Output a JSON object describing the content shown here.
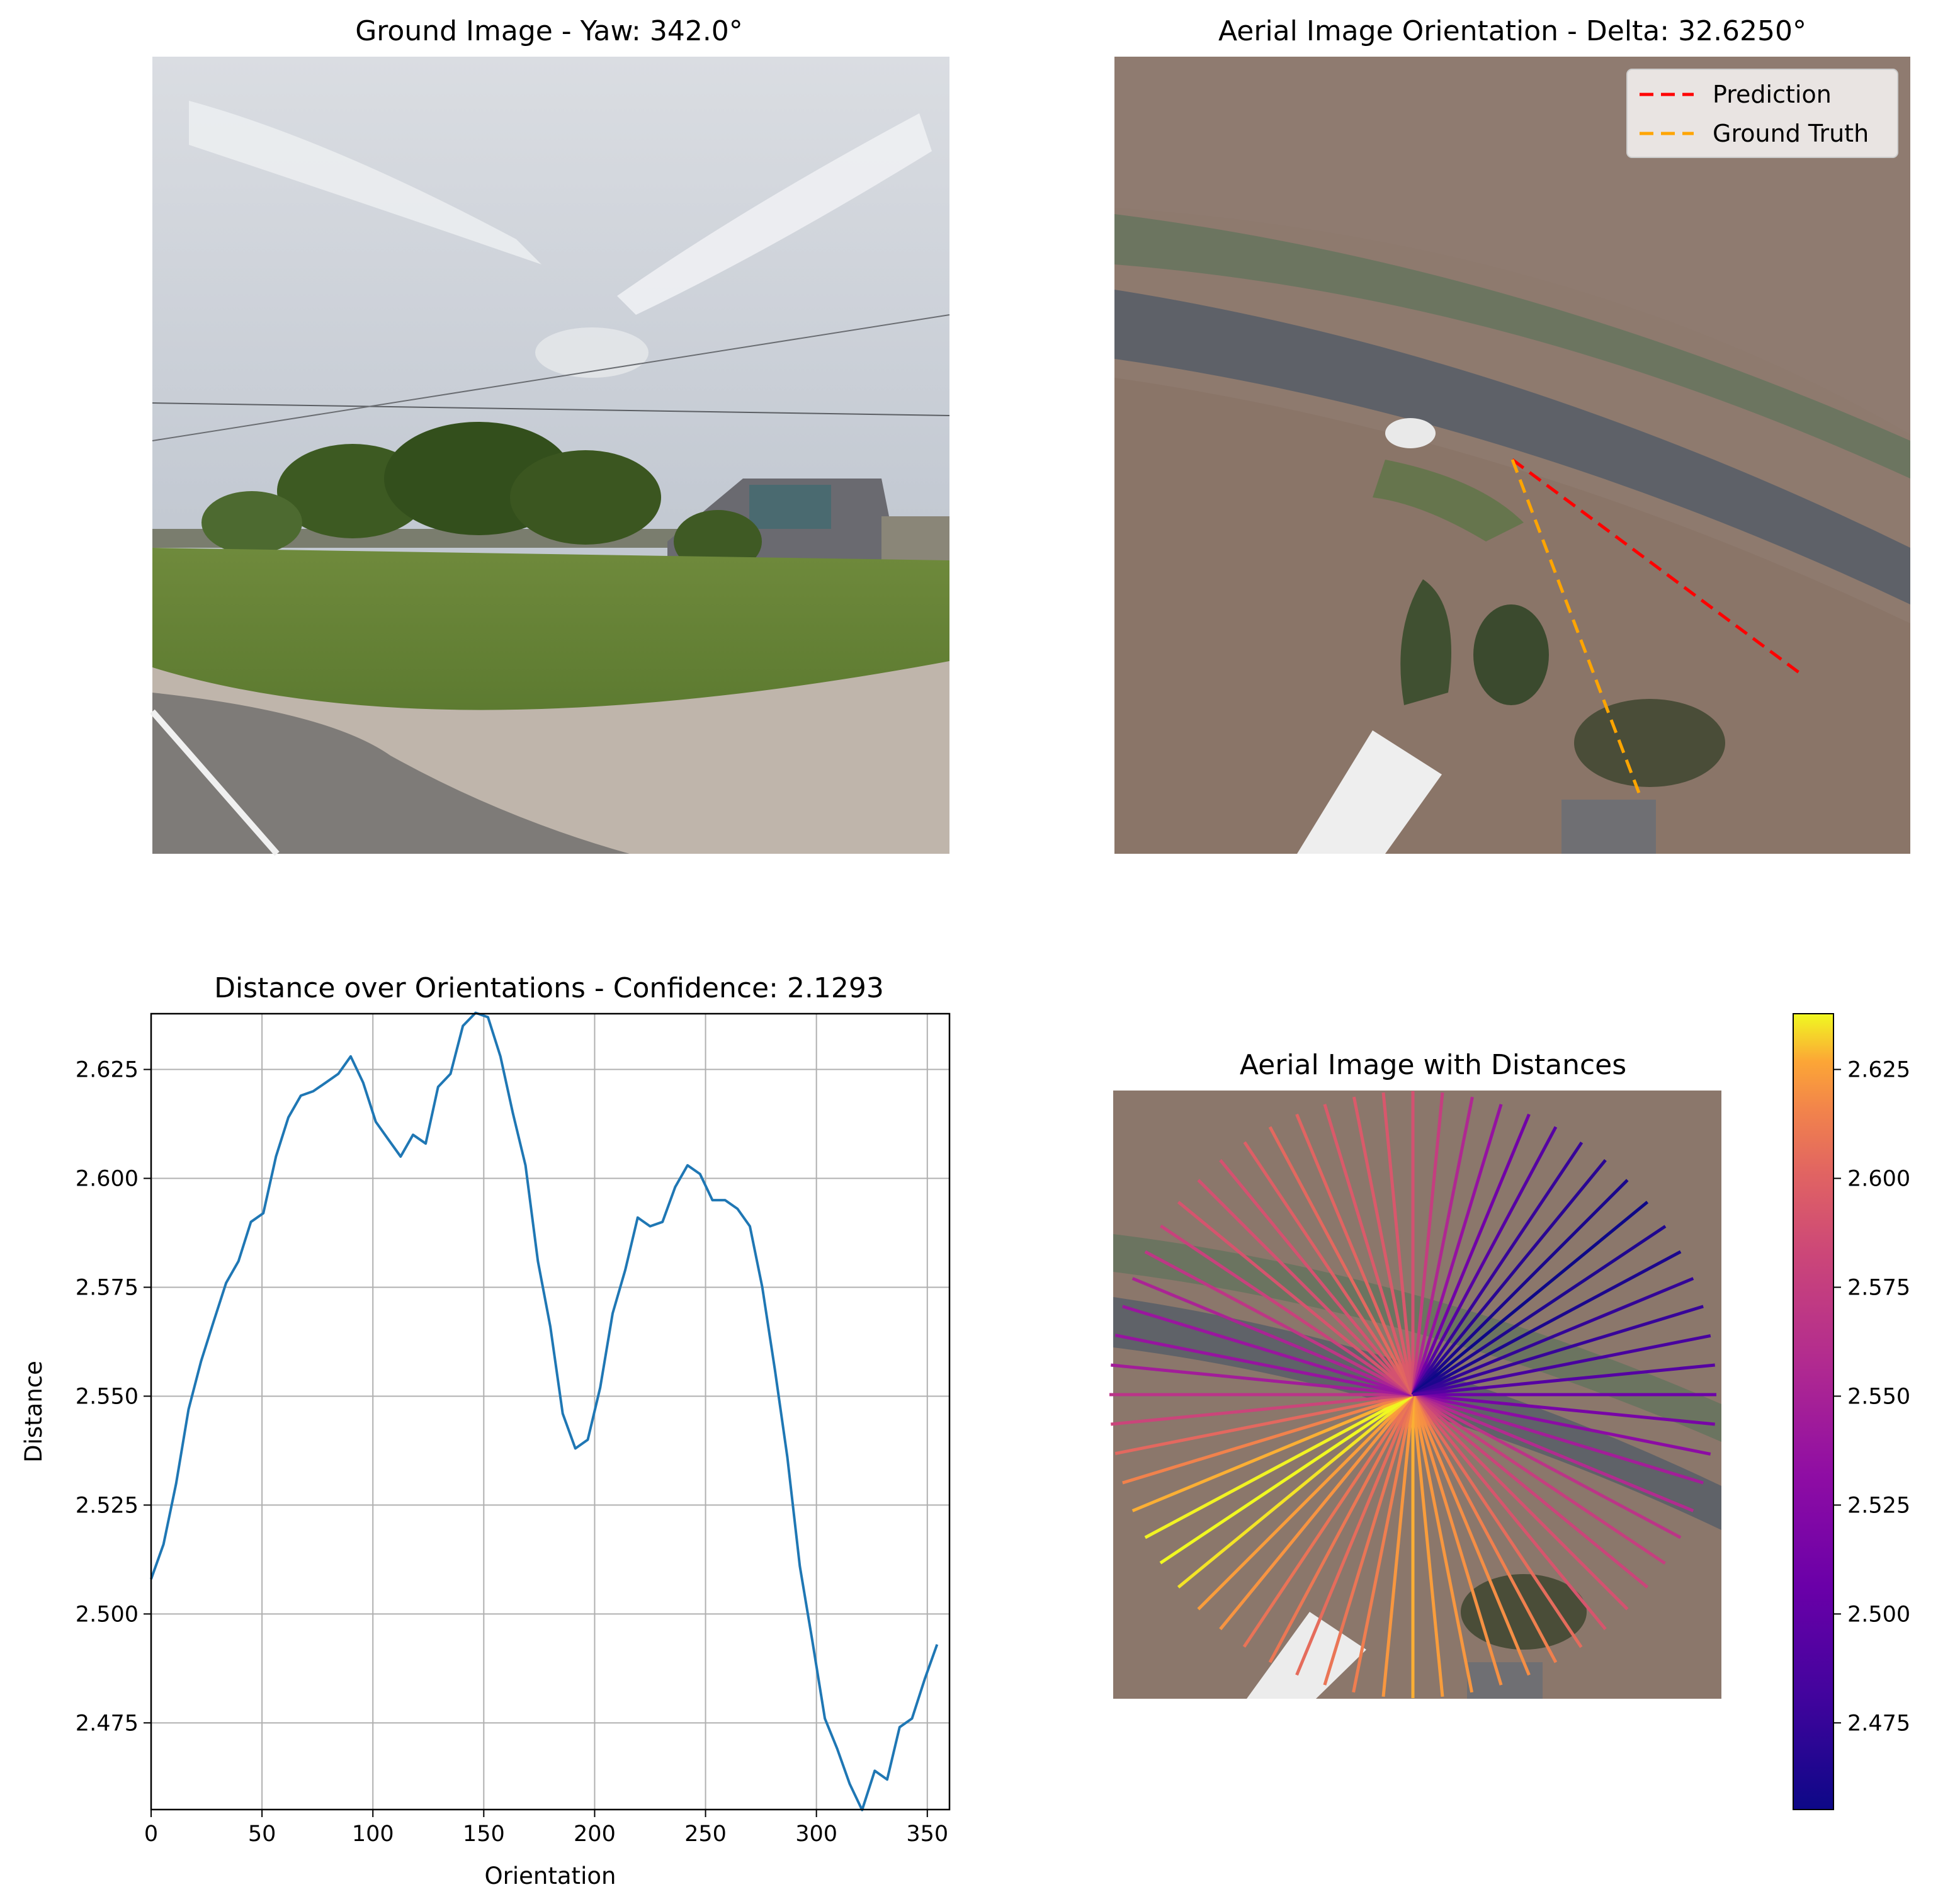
{
  "panels": {
    "ground": {
      "title": "Ground Image - Yaw: 342.0°"
    },
    "aerial": {
      "title": "Aerial Image Orientation - Delta: 32.6250°",
      "legend": [
        {
          "label": "Prediction",
          "color": "#ff0000"
        },
        {
          "label": "Ground Truth",
          "color": "#ffa500"
        }
      ],
      "prediction_angle_deg": 126.6,
      "ground_truth_angle_deg": 159.2
    },
    "distance": {
      "title": "Distance over Orientations - Confidence: 2.1293"
    },
    "radial": {
      "title": "Aerial Image with Distances"
    }
  },
  "chart_data": [
    {
      "type": "line",
      "title": "Distance over Orientations - Confidence: 2.1293",
      "xlabel": "Orientation",
      "ylabel": "Distance",
      "xlim": [
        0,
        360
      ],
      "ylim": [
        2.4551,
        2.6378
      ],
      "x_ticks": [
        0,
        50,
        100,
        150,
        200,
        250,
        300,
        350
      ],
      "y_ticks": [
        2.475,
        2.5,
        2.525,
        2.55,
        2.575,
        2.6,
        2.625
      ],
      "x_tick_labels": [
        "0",
        "50",
        "100",
        "150",
        "200",
        "250",
        "300",
        "350"
      ],
      "y_tick_labels": [
        "2.475",
        "2.500",
        "2.525",
        "2.550",
        "2.575",
        "2.600",
        "2.625"
      ],
      "grid": true,
      "color": "#1f77b4",
      "x": [
        0,
        5.6,
        11.3,
        16.9,
        22.5,
        28.1,
        33.8,
        39.4,
        45,
        50.6,
        56.3,
        61.9,
        67.5,
        73.1,
        78.8,
        84.4,
        90,
        95.6,
        101.3,
        106.9,
        112.5,
        118.1,
        123.8,
        129.4,
        135,
        140.6,
        146.3,
        151.9,
        157.5,
        163.1,
        168.8,
        174.4,
        180,
        185.6,
        191.3,
        196.9,
        202.5,
        208.1,
        213.8,
        219.4,
        225,
        230.6,
        236.3,
        241.9,
        247.5,
        253.1,
        258.8,
        264.4,
        270,
        275.6,
        281.3,
        286.9,
        292.5,
        298.1,
        303.8,
        309.4,
        315,
        320.6,
        326.3,
        331.9,
        337.5,
        343.1,
        348.8,
        354.4
      ],
      "y": [
        2.508,
        2.516,
        2.53,
        2.547,
        2.558,
        2.567,
        2.576,
        2.581,
        2.59,
        2.592,
        2.605,
        2.614,
        2.619,
        2.62,
        2.622,
        2.624,
        2.628,
        2.622,
        2.613,
        2.609,
        2.605,
        2.61,
        2.608,
        2.621,
        2.624,
        2.635,
        2.638,
        2.637,
        2.628,
        2.615,
        2.603,
        2.581,
        2.566,
        2.546,
        2.538,
        2.54,
        2.552,
        2.569,
        2.579,
        2.591,
        2.589,
        2.59,
        2.598,
        2.603,
        2.601,
        2.595,
        2.595,
        2.593,
        2.589,
        2.575,
        2.556,
        2.536,
        2.511,
        2.494,
        2.476,
        2.469,
        2.461,
        2.455,
        2.464,
        2.462,
        2.474,
        2.476,
        2.485,
        2.493
      ]
    },
    {
      "type": "colorbar",
      "colormap": "plasma",
      "ylim": [
        2.4551,
        2.6378
      ],
      "ticks": [
        2.475,
        2.5,
        2.525,
        2.55,
        2.575,
        2.6,
        2.625
      ],
      "tick_labels": [
        "2.475",
        "2.500",
        "2.525",
        "2.550",
        "2.575",
        "2.600",
        "2.625"
      ]
    }
  ]
}
